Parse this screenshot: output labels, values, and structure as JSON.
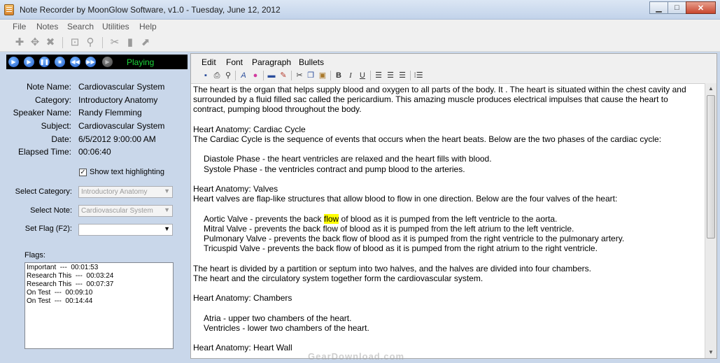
{
  "window": {
    "title": "Note Recorder by MoonGlow Software, v1.0  -  Tuesday, June 12, 2012",
    "minimize": "▁",
    "maximize": "□",
    "close": "✕"
  },
  "menubar": [
    "File",
    "Notes",
    "Search",
    "Utilities",
    "Help"
  ],
  "toolbar_icons": [
    "add-icon",
    "move-icon",
    "delete-icon",
    "find-icon",
    "search-icon",
    "tools-icon",
    "note-icon",
    "export-icon"
  ],
  "player": {
    "buttons": [
      "play",
      "rewind-play",
      "pause",
      "stop",
      "rewind",
      "fast-forward",
      "record"
    ],
    "status": "Playing"
  },
  "note": {
    "fields": [
      {
        "label": "Note Name:",
        "value": "Cardiovascular System"
      },
      {
        "label": "Category:",
        "value": "Introductory Anatomy"
      },
      {
        "label": "Speaker Name:",
        "value": "Randy Flemming"
      },
      {
        "label": "Subject:",
        "value": "Cardiovascular System"
      },
      {
        "label": "Date:",
        "value": "6/5/2012 9:00:00 AM"
      },
      {
        "label": "Elapsed Time:",
        "value": "00:06:40"
      }
    ],
    "show_highlight_label": "Show text highlighting",
    "show_highlight_checked": true
  },
  "selectors": {
    "category_label": "Select Category:",
    "category_value": "Introductory Anatomy",
    "note_label": "Select Note:",
    "note_value": "Cardiovascular System",
    "flag_label": "Set Flag (F2):",
    "flag_value": ""
  },
  "flags": {
    "label": "Flags:",
    "items": [
      "Important  ---  00:01:53",
      "Research This  ---  00:03:24",
      "Research This  ---  00:07:37",
      "On Test  ---  00:09:10",
      "On Test  ---  00:14:44"
    ]
  },
  "editor": {
    "menu": [
      "Edit",
      "Font",
      "Paragraph",
      "Bullets"
    ],
    "tool_icons": [
      "save-icon",
      "print-icon",
      "preview-icon",
      "font-icon",
      "color-icon",
      "highlight-icon",
      "eraser-icon",
      "cut-icon",
      "copy-icon",
      "paste-icon",
      "bold-icon",
      "italic-icon",
      "underline-icon",
      "align-left-icon",
      "align-center-icon",
      "align-right-icon",
      "list-icon"
    ],
    "bold": "B",
    "italic": "I",
    "underline": "U"
  },
  "document": {
    "intro": "The heart is the organ that helps supply blood and oxygen to all parts of the body. It . The heart is situated within the chest cavity and surrounded by a fluid filled sac called the pericardium. This amazing muscle produces electrical impulses that cause the heart to contract, pumping blood throughout the body.",
    "cycle_heading": "Heart Anatomy: Cardiac Cycle",
    "cycle_text": "The Cardiac Cycle is the sequence of events that occurs when the heart beats. Below are the two phases of the cardiac cycle:",
    "diastole": "Diastole Phase - the heart ventricles are relaxed and the heart fills with blood.",
    "systole": "Systole Phase - the ventricles contract and pump blood to the arteries.",
    "valves_heading": "Heart Anatomy: Valves",
    "valves_text": "Heart valves are flap-like structures that allow blood to flow in one direction. Below are the four valves of the heart:",
    "aortic_pre": "Aortic Valve - prevents the back ",
    "aortic_hl": "flow",
    "aortic_post": " of blood as it is pumped from the left ventricle to the aorta.",
    "mitral": "Mitral Valve - prevents the back flow of blood as it is pumped from the left atrium to the left ventricle.",
    "pulmonary": "Pulmonary Valve - prevents the back flow of blood as it is pumped from the right ventricle to the pulmonary artery.",
    "tricuspid": "Tricuspid Valve - prevents the back flow of blood as it is pumped from the right atrium to the right ventricle.",
    "divided": "The heart is divided by a partition or septum into two halves, and the halves are divided into four chambers.",
    "circulatory": "The heart and the circulatory system together form the cardiovascular system.",
    "chambers_heading": "Heart Anatomy: Chambers",
    "atria": "Atria - upper two chambers of the heart.",
    "ventricles": "Ventricles - lower two chambers of the heart.",
    "wall_heading": "Heart Anatomy: Heart Wall"
  },
  "watermark": "GearDownload.com",
  "colors": {
    "panel": "#c9d7ea",
    "playing": "#1bd43a",
    "highlight": "#ffff00"
  }
}
